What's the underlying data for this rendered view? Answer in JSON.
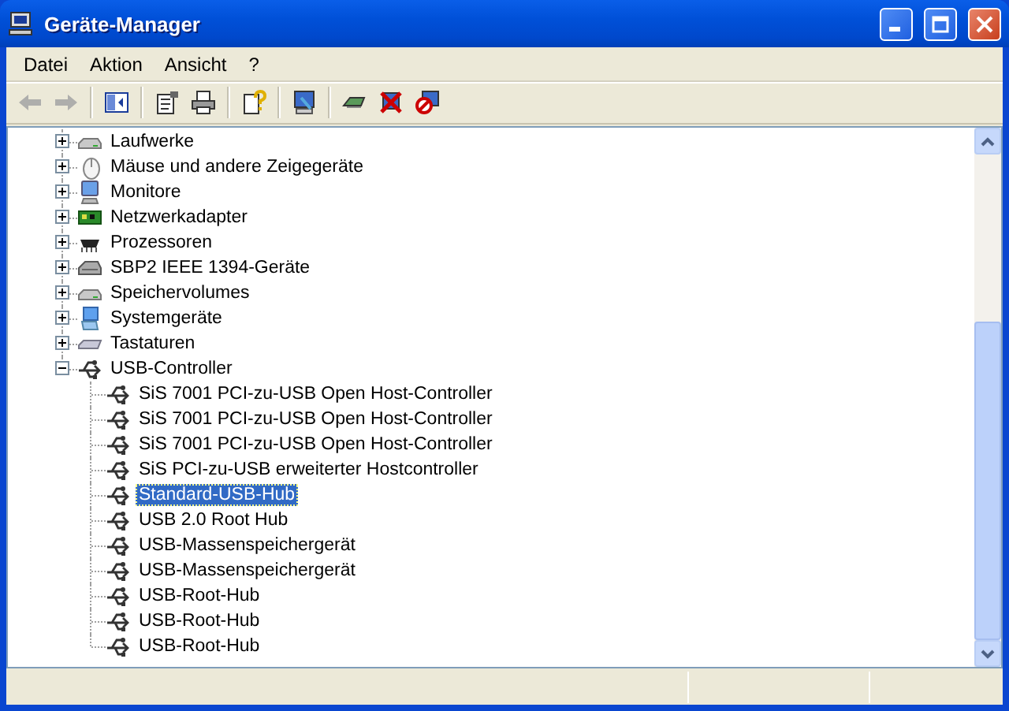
{
  "window": {
    "title": "Geräte-Manager"
  },
  "menu": [
    {
      "label": "Datei"
    },
    {
      "label": "Aktion"
    },
    {
      "label": "Ansicht"
    },
    {
      "label": "?"
    }
  ],
  "toolbar": [
    {
      "kind": "back",
      "disabled": true
    },
    {
      "kind": "forward",
      "disabled": true
    },
    {
      "kind": "sep"
    },
    {
      "kind": "tree",
      "disabled": false
    },
    {
      "kind": "sep"
    },
    {
      "kind": "properties",
      "disabled": false
    },
    {
      "kind": "print",
      "disabled": false
    },
    {
      "kind": "sep"
    },
    {
      "kind": "help",
      "disabled": false
    },
    {
      "kind": "sep"
    },
    {
      "kind": "scan",
      "disabled": false
    },
    {
      "kind": "sep"
    },
    {
      "kind": "update",
      "disabled": false
    },
    {
      "kind": "uninstall",
      "disabled": false
    },
    {
      "kind": "disable",
      "disabled": false
    }
  ],
  "tree": {
    "items": [
      {
        "label": "Laufwerke",
        "kind": "drive",
        "expanded": false,
        "selected": false
      },
      {
        "label": "Mäuse und andere Zeigegeräte",
        "kind": "mouse",
        "expanded": false,
        "selected": false
      },
      {
        "label": "Monitore",
        "kind": "monitor",
        "expanded": false,
        "selected": false
      },
      {
        "label": "Netzwerkadapter",
        "kind": "network",
        "expanded": false,
        "selected": false
      },
      {
        "label": "Prozessoren",
        "kind": "cpu",
        "expanded": false,
        "selected": false
      },
      {
        "label": "SBP2 IEEE 1394-Geräte",
        "kind": "ieee",
        "expanded": false,
        "selected": false
      },
      {
        "label": "Speichervolumes",
        "kind": "drive",
        "expanded": false,
        "selected": false
      },
      {
        "label": "Systemgeräte",
        "kind": "system",
        "expanded": false,
        "selected": false
      },
      {
        "label": "Tastaturen",
        "kind": "keyboard",
        "expanded": false,
        "selected": false
      },
      {
        "label": "USB-Controller",
        "kind": "usb",
        "expanded": true,
        "selected": false,
        "children": [
          {
            "label": "SiS 7001 PCI-zu-USB Open Host-Controller",
            "kind": "usb",
            "selected": false
          },
          {
            "label": "SiS 7001 PCI-zu-USB Open Host-Controller",
            "kind": "usb",
            "selected": false
          },
          {
            "label": "SiS 7001 PCI-zu-USB Open Host-Controller",
            "kind": "usb",
            "selected": false
          },
          {
            "label": "SiS PCI-zu-USB erweiterter Hostcontroller",
            "kind": "usb",
            "selected": false
          },
          {
            "label": "Standard-USB-Hub",
            "kind": "usb",
            "selected": true
          },
          {
            "label": "USB 2.0 Root Hub",
            "kind": "usb",
            "selected": false
          },
          {
            "label": "USB-Massenspeichergerät",
            "kind": "usb",
            "selected": false
          },
          {
            "label": "USB-Massenspeichergerät",
            "kind": "usb",
            "selected": false
          },
          {
            "label": "USB-Root-Hub",
            "kind": "usb",
            "selected": false
          },
          {
            "label": "USB-Root-Hub",
            "kind": "usb",
            "selected": false
          },
          {
            "label": "USB-Root-Hub",
            "kind": "usb",
            "selected": false
          }
        ]
      }
    ]
  }
}
